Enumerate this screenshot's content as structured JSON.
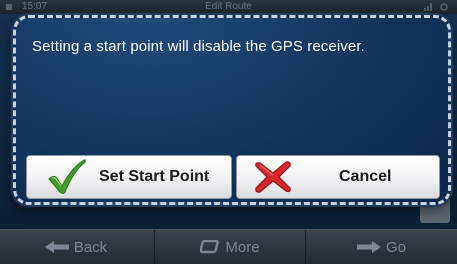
{
  "status_bar": {
    "time": "15:07",
    "title": "Edit Route"
  },
  "bottom_bar": {
    "back_label": "Back",
    "more_label": "More",
    "go_label": "Go"
  },
  "dialog": {
    "message": "Setting a start point will disable the GPS receiver.",
    "set_start_point_label": "Set Start Point",
    "cancel_label": "Cancel"
  },
  "icons": {
    "confirm": "checkmark-icon",
    "cancel": "red-x-icon",
    "back": "arrow-left-icon",
    "more": "window-icon",
    "go": "arrow-right-icon"
  },
  "colors": {
    "dialog_bg": "#143862",
    "dialog_border": "#c9d3de",
    "check_green": "#3f9e2a",
    "cancel_red": "#d7262b"
  }
}
